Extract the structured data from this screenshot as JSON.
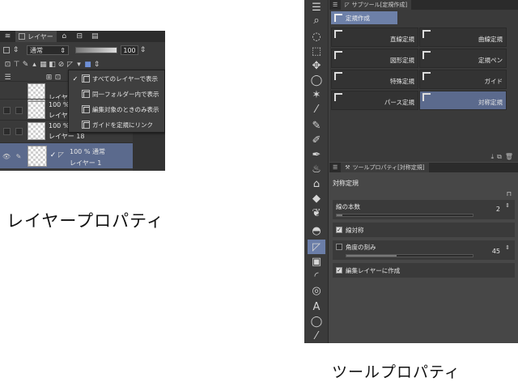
{
  "captions": {
    "layer_property": "レイヤープロパティ",
    "tool_property": "ツールプロパティ"
  },
  "layer_panel": {
    "tab_label": "レイヤー",
    "blend_mode": "通常",
    "opacity_value": "100",
    "menu": {
      "items": [
        {
          "label": "すべてのレイヤーで表示",
          "checked": true
        },
        {
          "label": "同一フォルダー内で表示",
          "checked": false
        },
        {
          "label": "編集対象のときのみ表示",
          "checked": false
        },
        {
          "label": "ガイドを定規にリンク",
          "checked": false
        }
      ]
    },
    "layers": [
      {
        "line1": "",
        "line2": "レイヤ"
      },
      {
        "line1": "100 %",
        "line2": "レイヤ"
      },
      {
        "line1": "100 %",
        "line2": "レイヤー 18"
      },
      {
        "line1": "100 % 通常",
        "line2": "レイヤー 1",
        "selected": true
      }
    ]
  },
  "tool_panel": {
    "subtool_header": "サブツール[定規作成]",
    "group_tab": "定規作成",
    "tools": [
      {
        "name": "直線定規"
      },
      {
        "name": "曲線定規"
      },
      {
        "name": "図形定規"
      },
      {
        "name": "定規ペン"
      },
      {
        "name": "特殊定規"
      },
      {
        "name": "ガイド"
      },
      {
        "name": "パース定規"
      },
      {
        "name": "対称定規",
        "active": true
      }
    ],
    "property_header": "ツールプロパティ[対称定規]",
    "property_title": "対称定規",
    "line_count": {
      "label": "線の本数",
      "value": "2"
    },
    "line_symmetry": {
      "label": "線対称",
      "checked": true
    },
    "angle_step": {
      "label": "角度の刻み",
      "value": "45",
      "checked": false
    },
    "create_on_edit_layer": {
      "label": "編集レイヤーに作成",
      "checked": true
    }
  },
  "colors": {
    "selection": "#5b6a8d",
    "accent_blue": "#6d80a8"
  }
}
